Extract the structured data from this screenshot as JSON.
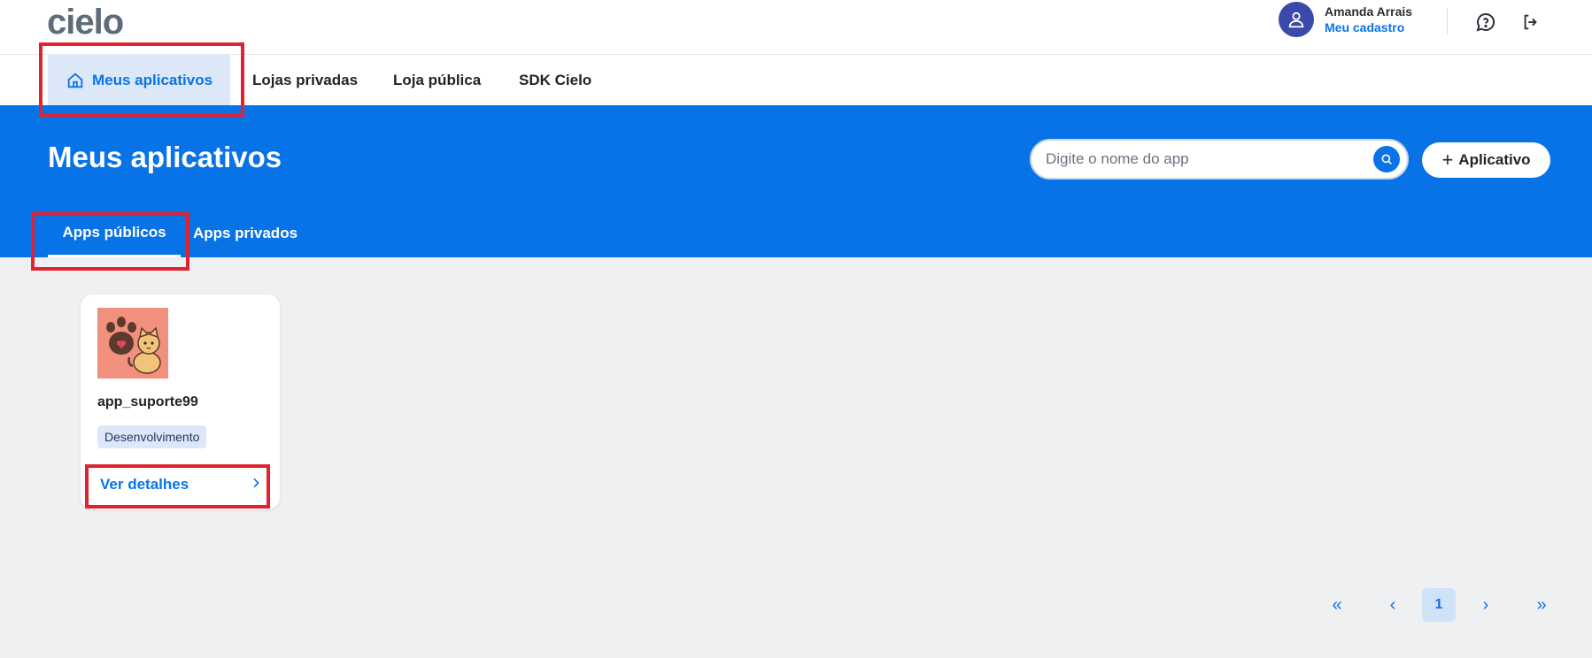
{
  "header": {
    "logo_text": "cielo",
    "user_name": "Amanda Arrais",
    "user_link": "Meu cadastro"
  },
  "icons": {
    "avatar": "user-icon",
    "help": "help-chat-icon",
    "logout": "logout-icon",
    "home": "home-icon",
    "search": "search-icon",
    "plus": "plus-icon",
    "chevron": "chevron-right-icon"
  },
  "nav": {
    "items": [
      {
        "label": "Meus aplicativos"
      },
      {
        "label": "Lojas privadas"
      },
      {
        "label": "Loja pública"
      },
      {
        "label": "SDK Cielo"
      }
    ]
  },
  "banner": {
    "title": "Meus aplicativos",
    "search_placeholder": "Digite o nome do app",
    "add_button": "Aplicativo",
    "tabs": [
      {
        "label": "Apps públicos"
      },
      {
        "label": "Apps privados"
      }
    ]
  },
  "apps": [
    {
      "name": "app_suporte99",
      "status": "Desenvolvimento",
      "details_link": "Ver detalhes"
    }
  ],
  "pagination": {
    "first": "«",
    "prev": "‹",
    "current_page": "1",
    "next": "›",
    "last": "»"
  },
  "colors": {
    "primary": "#0873e6",
    "banner_background": "#0873e6",
    "page_background": "#eff0f2",
    "active_nav_background": "#dce8f7",
    "highlight": "#e0232e"
  }
}
